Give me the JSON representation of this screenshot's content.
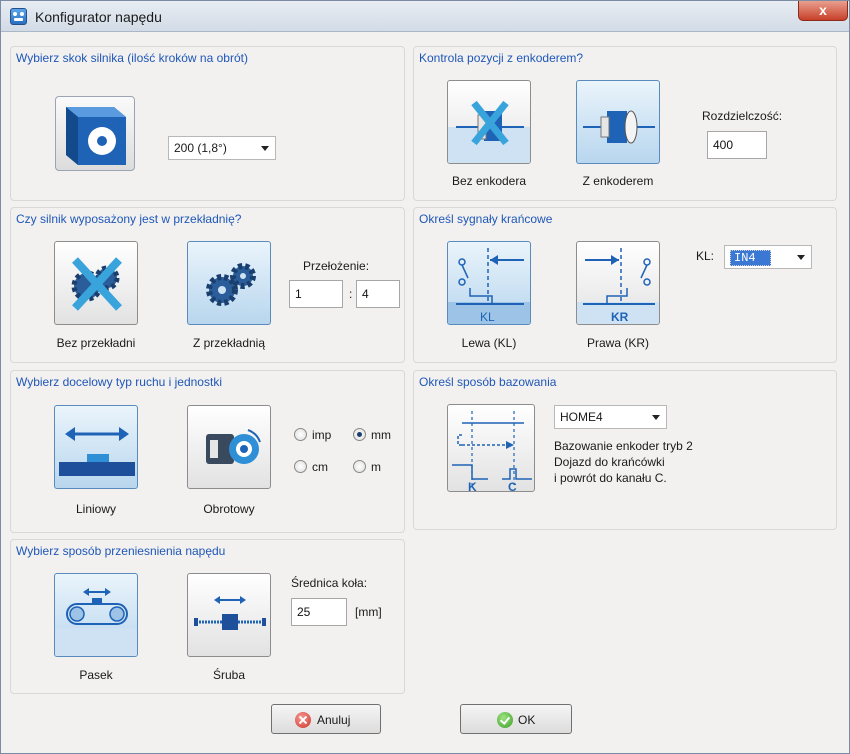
{
  "window": {
    "title": "Konfigurator napędu",
    "close_label": "x"
  },
  "motor_step": {
    "title": "Wybierz skok silnika (ilość kroków na obrót)",
    "selected": "200  (1,8°)",
    "icon": "stepper-motor-icon"
  },
  "encoder": {
    "title": "Kontrola pozycji z enkoderem?",
    "option_without": "Bez enkodera",
    "option_with": "Z enkoderem",
    "resolution_label": "Rozdzielczość:",
    "resolution_value": "400"
  },
  "gearbox": {
    "title": "Czy silnik wyposażony jest w przekładnię?",
    "option_without": "Bez przekładni",
    "option_with": "Z przekładnią",
    "ratio_label": "Przełożenie:",
    "ratio_in": "1",
    "ratio_sep": ":",
    "ratio_out": "4"
  },
  "limits": {
    "title": "Określ sygnały krańcowe",
    "left_label": "Lewa (KL)",
    "right_label": "Prawa (KR)",
    "left_mark": "KL",
    "right_mark": "KR",
    "kl_label": "KL:",
    "kl_value": "IN4",
    "kl_highlight": "#3b78d4"
  },
  "motion": {
    "title": "Wybierz docelowy typ ruchu i jednostki",
    "linear_label": "Liniowy",
    "rotary_label": "Obrotowy",
    "units": [
      {
        "label": "imp",
        "checked": false
      },
      {
        "label": "mm",
        "checked": true
      },
      {
        "label": "cm",
        "checked": false
      },
      {
        "label": "m",
        "checked": false
      }
    ]
  },
  "homing": {
    "title": "Określ sposób bazowania",
    "mode": "HOME4",
    "desc_line1": "Bazowanie enkoder tryb 2",
    "desc_line2": "Dojazd do krańcówki",
    "desc_line3": "i powrót do kanału C.",
    "mark_k": "K",
    "mark_c": "C"
  },
  "transmission": {
    "title": "Wybierz sposób przeniesnienia napędu",
    "belt_label": "Pasek",
    "screw_label": "Śruba",
    "diameter_label": "Średnica koła:",
    "diameter_value": "25",
    "diameter_unit": "[mm]"
  },
  "buttons": {
    "cancel": "Anuluj",
    "ok": "OK"
  },
  "colors": {
    "accent": "#1f57b8",
    "tile_active": "#b8d6ee",
    "icon_blue": "#1e63b6"
  }
}
